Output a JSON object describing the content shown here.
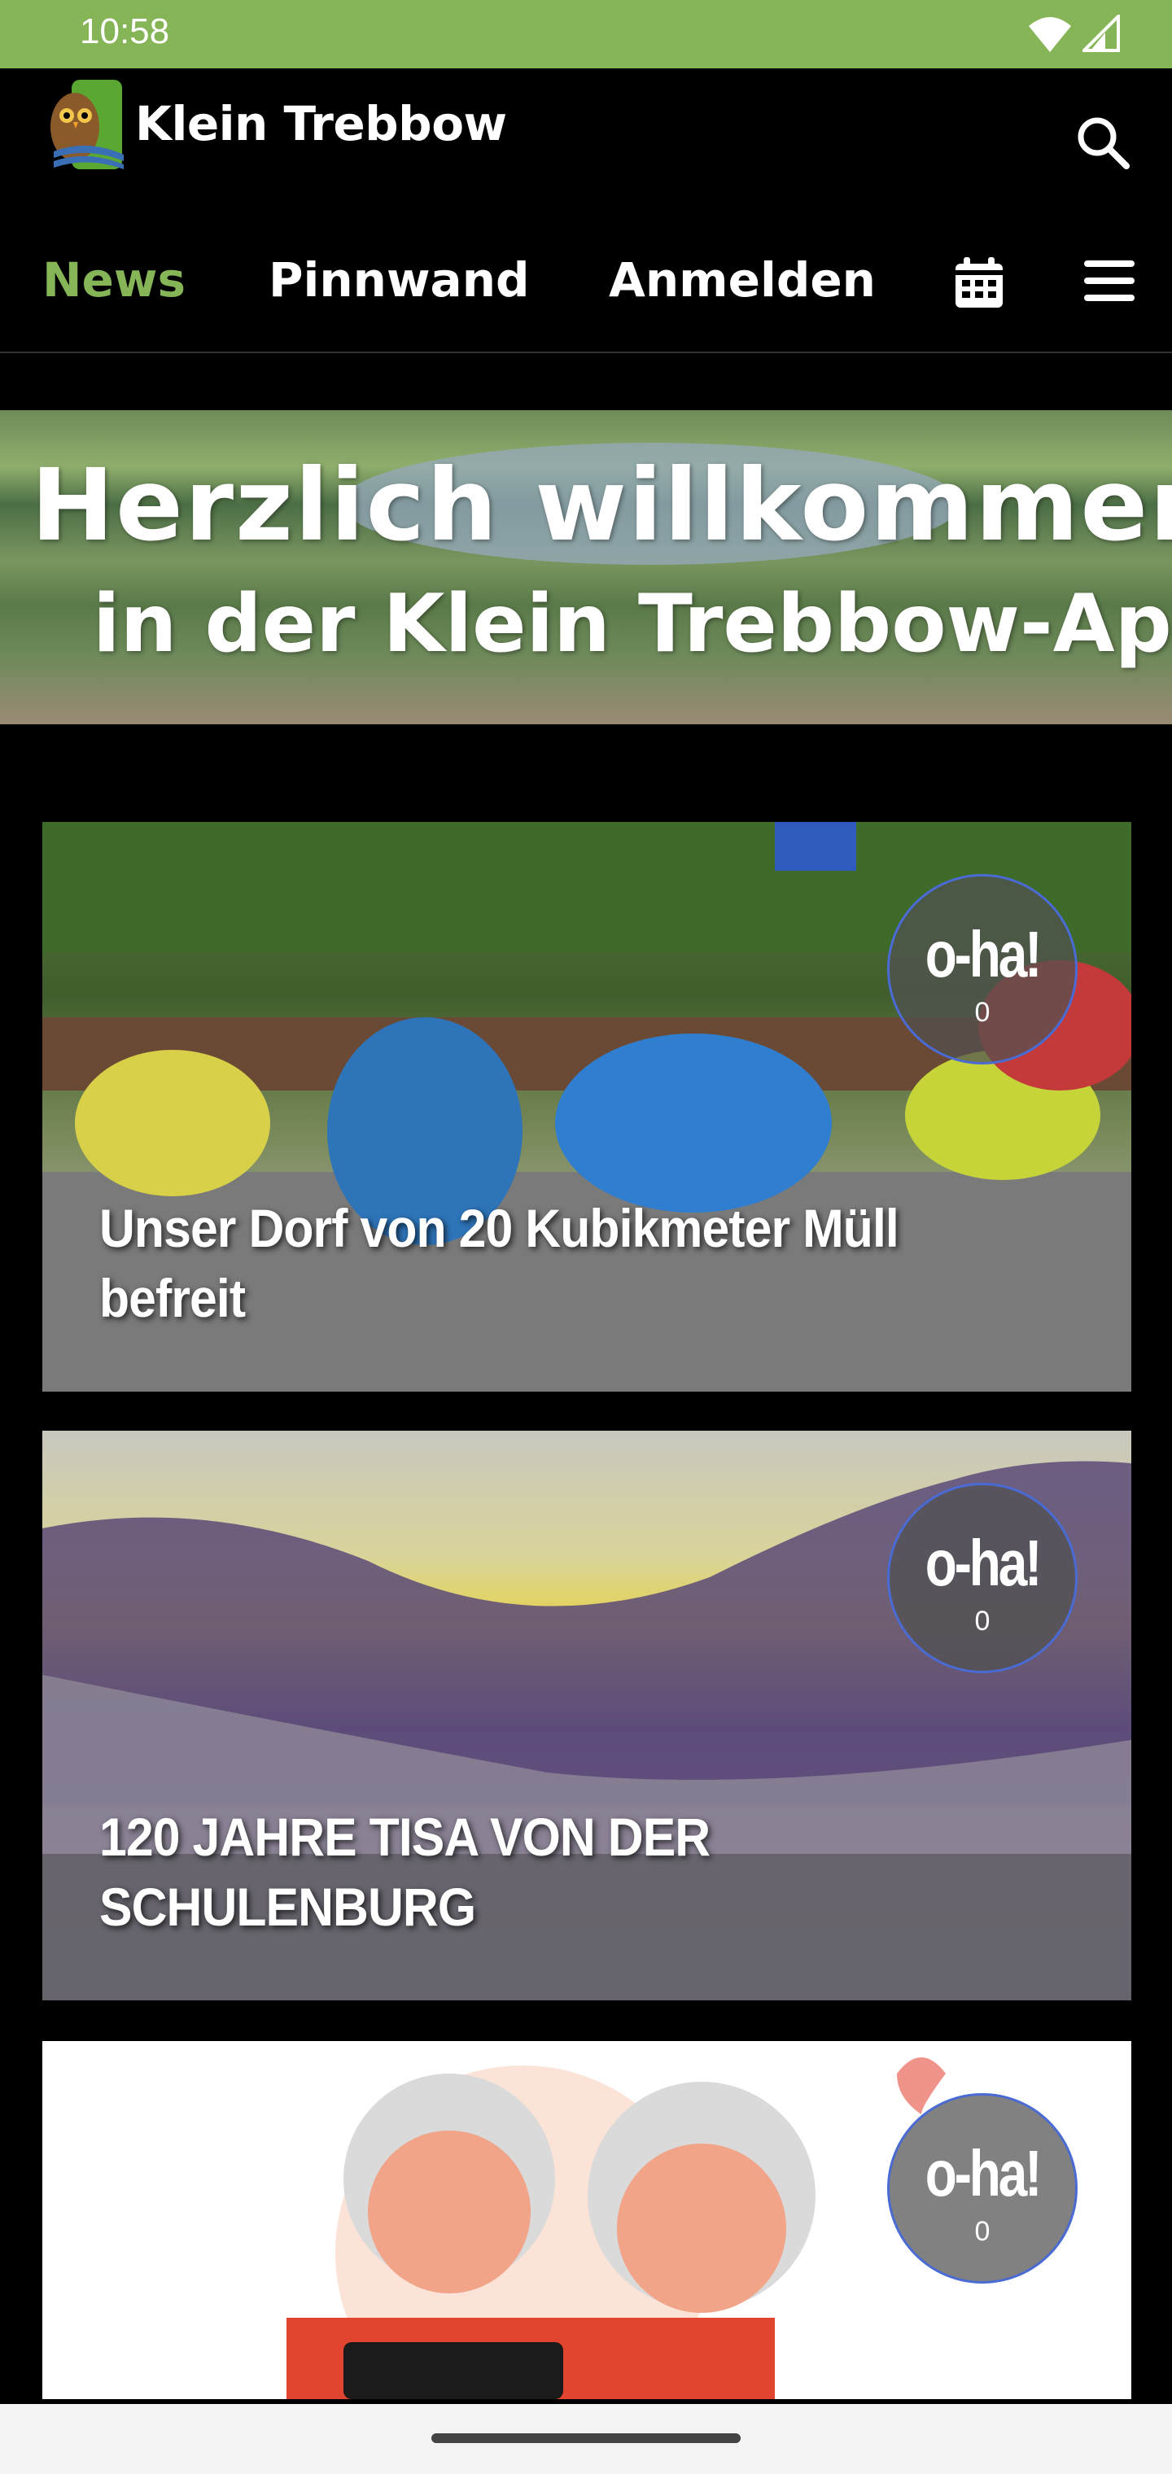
{
  "status_bar": {
    "time": "10:58"
  },
  "header": {
    "brand": "Klein Trebbow"
  },
  "tabs": [
    {
      "label": "News",
      "active": true
    },
    {
      "label": "Pinnwand",
      "active": false
    },
    {
      "label": "Anmelden",
      "active": false
    }
  ],
  "icons": {
    "search": "search-icon",
    "calendar": "calendar-icon",
    "menu": "menu-icon",
    "wifi": "wifi-icon",
    "signal": "signal-icon"
  },
  "banner": {
    "line1": "Herzlich willkommen",
    "line2": "in der Klein Trebbow-App!"
  },
  "news": [
    {
      "title": "Unser Dorf von 20 Kubikmeter Müll befreit",
      "reaction_label": "o-ha!",
      "reaction_count": "0"
    },
    {
      "title": "120 JAHRE TISA VON DER SCHULENBURG",
      "reaction_label": "o-ha!",
      "reaction_count": "0"
    },
    {
      "title": "",
      "reaction_label": "o-ha!",
      "reaction_count": "0"
    }
  ],
  "colors": {
    "accent": "#86b557",
    "status_bar": "#86b557",
    "background": "#000000"
  }
}
